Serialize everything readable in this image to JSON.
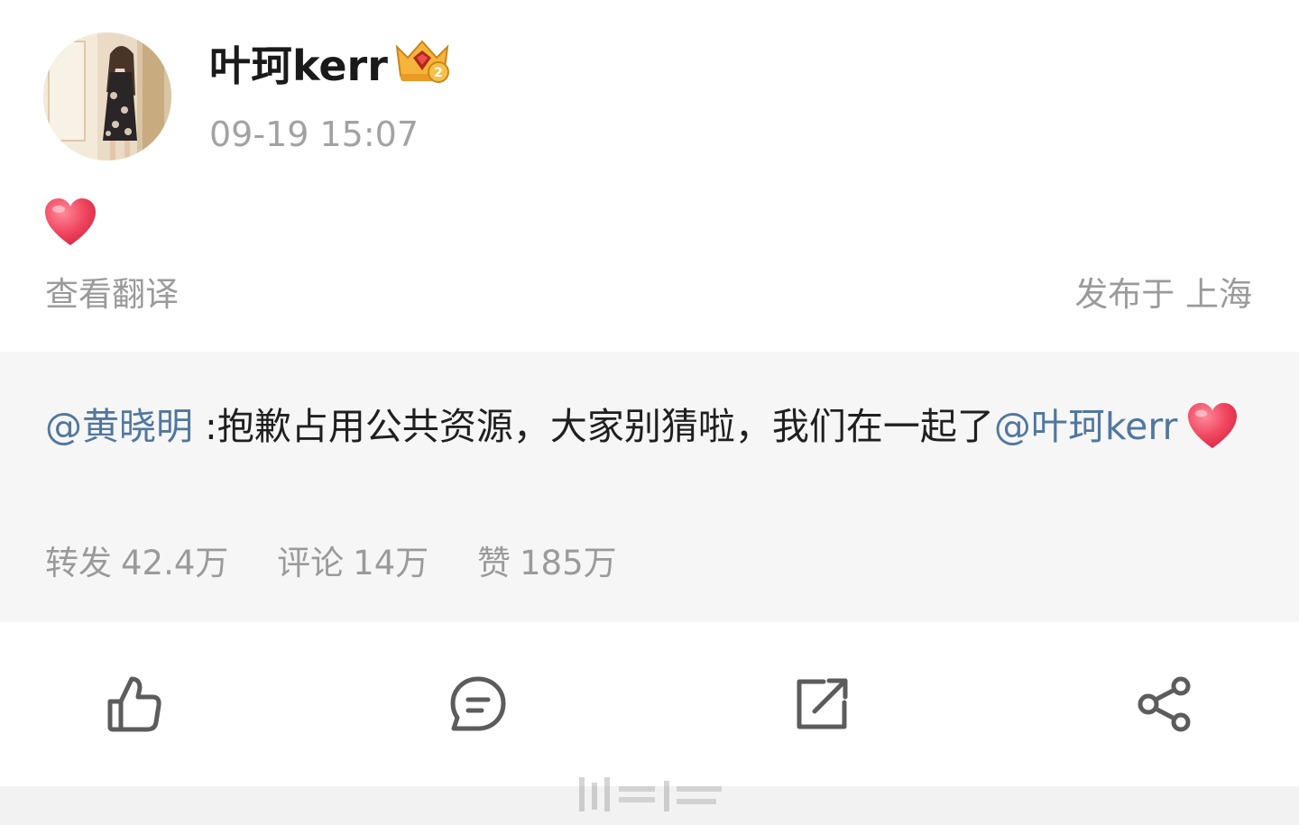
{
  "post": {
    "username": "叶珂kerr",
    "vip_badge_icon": "crown-diamond-vip-icon",
    "timestamp": "09-19 15:07",
    "body_icon": "red-heart-emoji",
    "translate_label": "查看翻译",
    "location_label": "发布于 上海"
  },
  "repost": {
    "author_mention": "@黄晓明",
    "text": " :抱歉占用公共资源，大家别猜啦，我们在一起了",
    "tail_mention": "@叶珂kerr",
    "tail_icon": "red-heart-emoji",
    "stats": [
      {
        "label": "转发",
        "value": "42.4万"
      },
      {
        "label": "评论",
        "value": "14万"
      },
      {
        "label": "赞",
        "value": "185万"
      }
    ]
  },
  "actions": [
    {
      "name": "like",
      "icon": "thumbs-up-icon"
    },
    {
      "name": "comment",
      "icon": "comment-bubble-icon"
    },
    {
      "name": "repost",
      "icon": "repost-arrow-icon"
    },
    {
      "name": "share",
      "icon": "share-nodes-icon"
    }
  ],
  "colors": {
    "mention": "#50779f",
    "muted": "#9a9a9a",
    "repost_bg": "#f6f6f6",
    "heart": "#f0445e"
  }
}
